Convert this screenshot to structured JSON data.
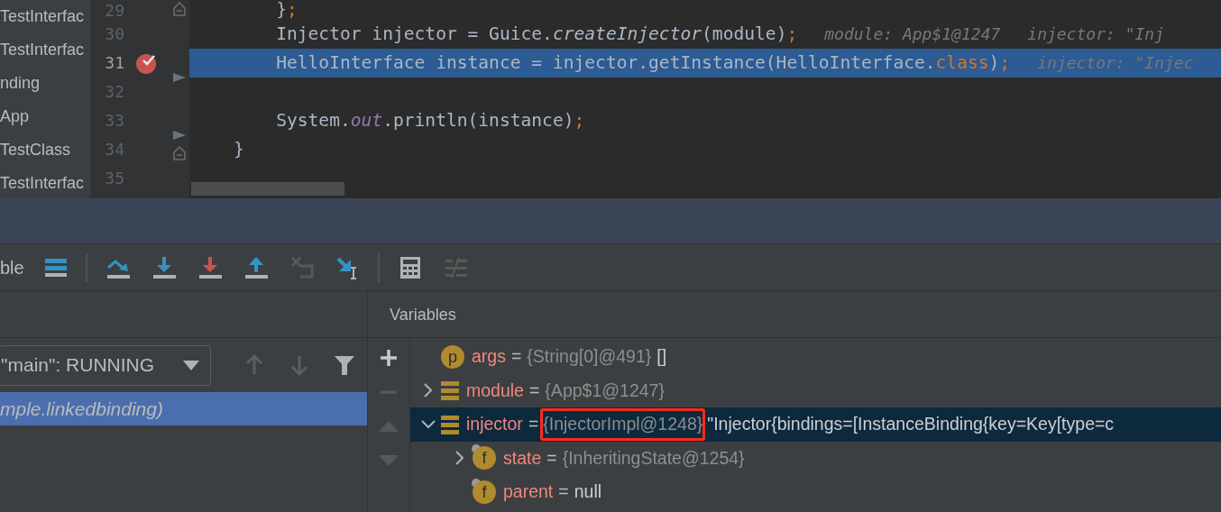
{
  "project_tree": {
    "items": [
      "TestInterfac",
      "TestInterfac",
      "nding",
      "App",
      "TestClass",
      "TestInterfac"
    ]
  },
  "editor": {
    "lines": [
      {
        "number": "29",
        "breakpoint": false,
        "current": false,
        "fold": true,
        "step_marker": false,
        "segments": [
          {
            "text": "    }",
            "kind": "plain"
          },
          {
            "text": ";",
            "kind": "keyword"
          }
        ]
      },
      {
        "number": "30",
        "breakpoint": false,
        "current": false,
        "fold": false,
        "step_marker": false,
        "segments": [
          {
            "text": "    Injector injector = Guice.",
            "kind": "plain"
          },
          {
            "text": "createInjector",
            "kind": "italic"
          },
          {
            "text": "(module)",
            "kind": "plain"
          },
          {
            "text": ";",
            "kind": "keyword"
          },
          {
            "text": "module: App$1@1247",
            "kind": "hint"
          },
          {
            "text": "injector: \"Inj",
            "kind": "hint"
          }
        ]
      },
      {
        "number": "31",
        "breakpoint": true,
        "current": true,
        "fold": false,
        "step_marker": true,
        "segments": [
          {
            "text": "    HelloInterface instance = injector.getInstance(HelloInterface.",
            "kind": "plain"
          },
          {
            "text": "class",
            "kind": "keyword"
          },
          {
            "text": ")",
            "kind": "plain"
          },
          {
            "text": ";",
            "kind": "keyword"
          },
          {
            "text": "injector: \"Injec",
            "kind": "hint"
          }
        ]
      },
      {
        "number": "32",
        "breakpoint": false,
        "current": false,
        "fold": false,
        "step_marker": false
      },
      {
        "number": "33",
        "breakpoint": false,
        "current": false,
        "fold": false,
        "step_marker": true,
        "segments": [
          {
            "text": "    System.",
            "kind": "plain"
          },
          {
            "text": "out",
            "kind": "field"
          },
          {
            "text": ".println(instance)",
            "kind": "plain"
          },
          {
            "text": ";",
            "kind": "keyword"
          }
        ]
      },
      {
        "number": "34",
        "breakpoint": false,
        "current": false,
        "fold": true,
        "step_marker": false,
        "segments": [
          {
            "text": "}",
            "kind": "plain"
          }
        ]
      },
      {
        "number": "35",
        "breakpoint": false,
        "current": false,
        "fold": false,
        "step_marker": false
      }
    ]
  },
  "toolbar": {
    "label": "ble",
    "buttons": [
      {
        "kind": "list",
        "disabled": false,
        "separator_after": true
      },
      {
        "kind": "step-over",
        "disabled": false,
        "separator_after": false
      },
      {
        "kind": "step-into",
        "disabled": false,
        "separator_after": false
      },
      {
        "kind": "force-step-into",
        "disabled": false,
        "separator_after": false
      },
      {
        "kind": "step-out",
        "disabled": false,
        "separator_after": false
      },
      {
        "kind": "drop-frame",
        "disabled": true,
        "separator_after": false
      },
      {
        "kind": "run-to-cursor",
        "disabled": false,
        "separator_after": true
      },
      {
        "kind": "evaluate",
        "disabled": false,
        "separator_after": false
      },
      {
        "kind": "trace",
        "disabled": true,
        "separator_after": false
      }
    ]
  },
  "frames": {
    "thread": "\"main\": RUNNING",
    "buttons": [
      {
        "kind": "up",
        "disabled": true
      },
      {
        "kind": "down",
        "disabled": true
      },
      {
        "kind": "filter",
        "disabled": false
      }
    ],
    "items": [
      {
        "text": "mple.linkedbinding)",
        "selected": true
      }
    ]
  },
  "variables": {
    "title": "Variables",
    "controls": [
      {
        "kind": "add",
        "disabled": false
      },
      {
        "kind": "remove",
        "disabled": true
      },
      {
        "kind": "up",
        "disabled": true
      },
      {
        "kind": "down",
        "disabled": true
      }
    ],
    "rows": [
      {
        "kind": "parameter",
        "badge": "p",
        "name": "args",
        "separator": "=",
        "expandable": false,
        "selected": false,
        "value": "{String[0]@491}",
        "dimmed": true,
        "highlighted": false,
        "detail": "[]"
      },
      {
        "kind": "object",
        "name": "module",
        "separator": "=",
        "expandable": true,
        "expanded": false,
        "selected": false,
        "value": "{App$1@1247}",
        "dimmed": true,
        "highlighted": false
      },
      {
        "kind": "object",
        "name": "injector",
        "separator": "=",
        "expandable": true,
        "expanded": true,
        "selected": true,
        "value": "{InjectorImpl@1248}",
        "dimmed": true,
        "highlighted": true,
        "detail": "\"Injector{bindings=[InstanceBinding{key=Key[type=c",
        "children": [
          {
            "kind": "field",
            "badge": "f",
            "name": "state",
            "separator": "=",
            "expandable": true,
            "expanded": false,
            "selected": false,
            "value": "{InheritingState@1254}",
            "dimmed": true,
            "highlighted": false
          },
          {
            "kind": "field",
            "badge": "f",
            "name": "parent",
            "separator": "=",
            "expandable": false,
            "selected": false,
            "value": "null",
            "dimmed": false,
            "highlighted": false
          }
        ]
      }
    ]
  }
}
